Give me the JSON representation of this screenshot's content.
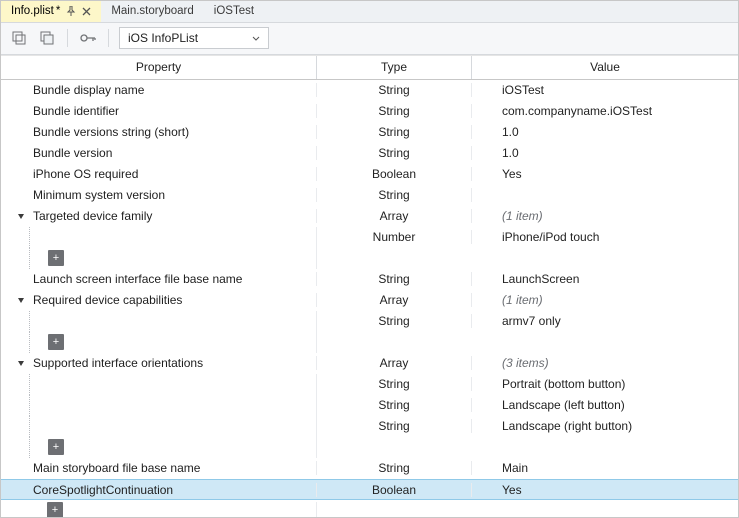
{
  "tabs": {
    "items": [
      {
        "label": "Info.plist",
        "active": true,
        "dirty": true,
        "pinned": true,
        "closeable": true
      },
      {
        "label": "Main.storyboard",
        "active": false,
        "dirty": false
      },
      {
        "label": "iOSTest",
        "active": false,
        "dirty": false
      }
    ]
  },
  "toolbar": {
    "dropdown_selected": "iOS InfoPList"
  },
  "grid": {
    "headers": {
      "property": "Property",
      "type": "Type",
      "value": "Value"
    }
  },
  "rows": [
    {
      "indent": 1,
      "property": "Bundle display name",
      "type": "String",
      "value": "iOSTest"
    },
    {
      "indent": 1,
      "property": "Bundle identifier",
      "type": "String",
      "value": "com.companyname.iOSTest"
    },
    {
      "indent": 1,
      "property": "Bundle versions string (short)",
      "type": "String",
      "value": "1.0"
    },
    {
      "indent": 1,
      "property": "Bundle version",
      "type": "String",
      "value": "1.0"
    },
    {
      "indent": 1,
      "property": "iPhone OS required",
      "type": "Boolean",
      "value": "Yes"
    },
    {
      "indent": 1,
      "property": "Minimum system version",
      "type": "String",
      "value": ""
    },
    {
      "indent": 1,
      "expander": "open",
      "property": "Targeted device family",
      "type": "Array",
      "value": "(1 item)",
      "italic": true
    },
    {
      "indent": 2,
      "child": true,
      "property": "",
      "type": "Number",
      "value": "iPhone/iPod touch"
    },
    {
      "indent": 2,
      "plus": true
    },
    {
      "indent": 1,
      "property": "Launch screen interface file base name",
      "type": "String",
      "value": "LaunchScreen"
    },
    {
      "indent": 1,
      "expander": "open",
      "property": "Required device capabilities",
      "type": "Array",
      "value": "(1 item)",
      "italic": true
    },
    {
      "indent": 2,
      "child": true,
      "property": "",
      "type": "String",
      "value": "armv7 only"
    },
    {
      "indent": 2,
      "plus": true
    },
    {
      "indent": 1,
      "expander": "open",
      "property": "Supported interface orientations",
      "type": "Array",
      "value": "(3 items)",
      "italic": true
    },
    {
      "indent": 2,
      "child": true,
      "property": "",
      "type": "String",
      "value": "Portrait (bottom button)"
    },
    {
      "indent": 2,
      "child": true,
      "property": "",
      "type": "String",
      "value": "Landscape (left button)"
    },
    {
      "indent": 2,
      "child": true,
      "property": "",
      "type": "String",
      "value": "Landscape (right button)"
    },
    {
      "indent": 2,
      "plus": true
    },
    {
      "indent": 1,
      "property": "Main storyboard file base name",
      "type": "String",
      "value": "Main"
    },
    {
      "indent": 1,
      "selected": true,
      "property": "CoreSpotlightContinuation",
      "type": "Boolean",
      "value": "Yes"
    },
    {
      "indent": 1,
      "plus": true
    }
  ],
  "icons": {
    "pin": "pin-icon",
    "close": "close-icon",
    "expand_all": "expand-all-icon",
    "collapse_all": "collapse-all-icon",
    "key": "key-icon",
    "chevron_down": "chevron-down-icon",
    "triangle_open": "triangle-open-icon"
  },
  "colors": {
    "selected_bg": "#cfe8f6",
    "active_tab_bg": "#fdf7c9"
  }
}
